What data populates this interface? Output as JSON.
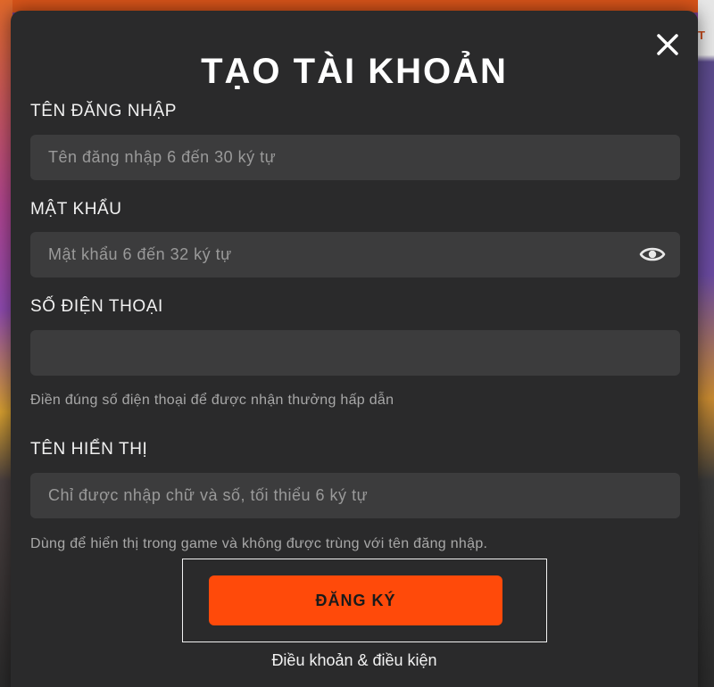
{
  "background": {
    "right_tab_text": "T"
  },
  "modal": {
    "title": "TẠO TÀI KHOẢN",
    "close_icon": "close-icon",
    "fields": {
      "username": {
        "label": "TÊN ĐĂNG NHẬP",
        "value": "",
        "placeholder": "Tên đăng nhập 6 đến 30 ký tự"
      },
      "password": {
        "label": "MẬT KHẨU",
        "value": "",
        "placeholder": "Mật khẩu 6 đến 32 ký tự",
        "toggle_icon": "eye-icon"
      },
      "phone": {
        "label": "SỐ ĐIỆN THOẠI",
        "value": "",
        "placeholder": "",
        "hint": "Điền đúng số điện thoại để được nhận thưởng hấp dẫn"
      },
      "display_name": {
        "label": "TÊN HIỂN THỊ",
        "value": "",
        "placeholder": "Chỉ được nhập chữ và số, tối thiểu 6 ký tự",
        "hint": "Dùng để hiển thị trong game và không được trùng với tên đăng nhập."
      }
    },
    "register_button": "ĐĂNG KÝ",
    "terms_link": "Điều khoản & điều kiện"
  },
  "colors": {
    "accent": "#ff4a0a",
    "modal_bg": "#2a2a2b",
    "input_bg": "#3c3c3d"
  }
}
